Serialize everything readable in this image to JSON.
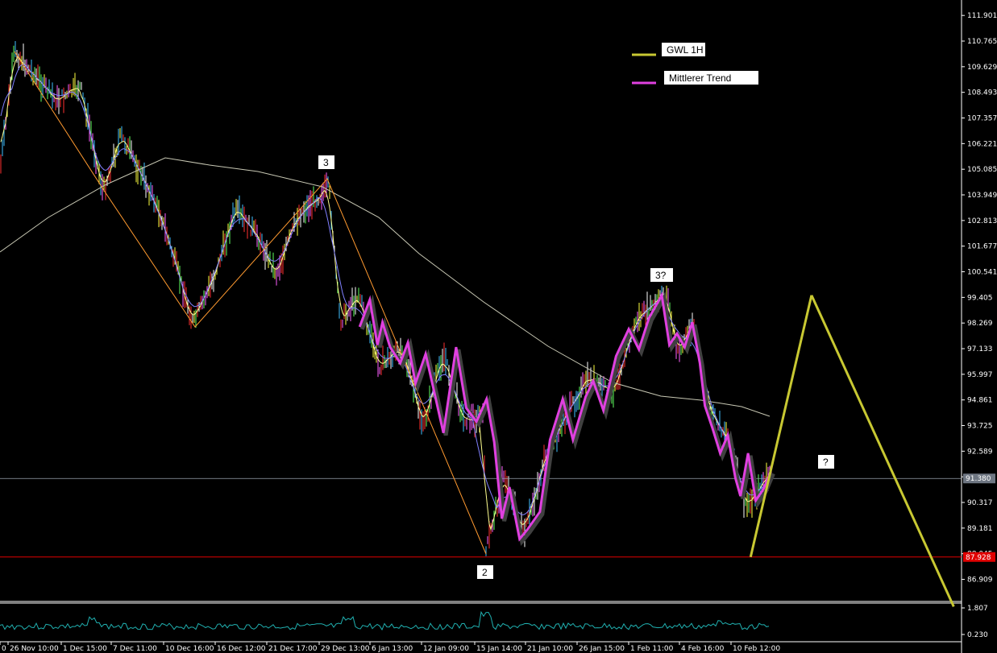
{
  "chart_data": {
    "type": "line",
    "y_ticks": [
      "111.901",
      "110.765",
      "109.629",
      "108.493",
      "107.357",
      "106.221",
      "105.085",
      "103.949",
      "102.813",
      "101.677",
      "100.541",
      "99.405",
      "98.269",
      "97.133",
      "95.997",
      "94.861",
      "93.725",
      "92.589",
      "91.453",
      "90.317",
      "89.181",
      "88.045",
      "86.909"
    ],
    "x_ticks": [
      "0",
      "26 Nov 10:00",
      "1 Dec 15:00",
      "7 Dec 11:00",
      "10 Dec 16:00",
      "16 Dec 12:00",
      "21 Dec 17:00",
      "29 Dec 13:00",
      "6 Jan 13:00",
      "12 Jan 09:00",
      "15 Jan 14:00",
      "21 Jan 10:00",
      "26 Jan 15:00",
      "1 Feb 11:00",
      "4 Feb 16:00",
      "10 Feb 12:00"
    ],
    "ylim": [
      86.0,
      112.3
    ],
    "current_price": {
      "value": 91.38,
      "label": "91.380",
      "color": "#9aa3b0"
    },
    "support_level": {
      "value": 87.9,
      "label": "87.928",
      "color": "#e00000"
    },
    "legend": [
      {
        "label": "GWL 1H",
        "color": "#c8c832"
      },
      {
        "label": "Mittlerer Trend",
        "color": "#e040e0"
      }
    ],
    "wave_labels": [
      {
        "text": "3",
        "x": "29 Dec",
        "y": 105.2
      },
      {
        "text": "3?",
        "x": "2 Feb",
        "y": 100.1
      },
      {
        "text": "2",
        "x": "15 Jan",
        "y": 87.1
      },
      {
        "text": "?",
        "x": "projection",
        "y": 92.0
      }
    ],
    "indicator_ticks": [
      "1.807",
      "0.230"
    ],
    "series": [
      {
        "name": "GWL 1H",
        "values": [
          [
            15.1,
            87.9
          ],
          [
            16.3,
            99.5
          ]
        ],
        "projection": [
          [
            16.3,
            99.5
          ],
          [
            19.1,
            85.7
          ]
        ]
      },
      {
        "name": "Mittlerer Trend",
        "values": [
          [
            7.4,
            98.1
          ],
          [
            7.6,
            99.3
          ],
          [
            7.75,
            97.3
          ],
          [
            7.85,
            98.3
          ],
          [
            8.0,
            97.2
          ],
          [
            8.2,
            96.5
          ],
          [
            8.35,
            97.4
          ],
          [
            8.5,
            95.6
          ],
          [
            8.7,
            96.9
          ],
          [
            8.9,
            94.9
          ],
          [
            9.05,
            93.4
          ],
          [
            9.3,
            97.2
          ],
          [
            9.5,
            94.5
          ],
          [
            9.7,
            93.9
          ],
          [
            9.9,
            94.9
          ],
          [
            10.05,
            93.0
          ],
          [
            10.2,
            89.6
          ],
          [
            10.35,
            91.0
          ],
          [
            10.55,
            88.7
          ],
          [
            10.7,
            89.1
          ],
          [
            10.95,
            89.9
          ],
          [
            11.15,
            93.1
          ],
          [
            11.4,
            94.9
          ],
          [
            11.6,
            93.1
          ],
          [
            11.85,
            95.0
          ],
          [
            12.0,
            95.7
          ],
          [
            12.2,
            94.4
          ],
          [
            12.45,
            96.8
          ],
          [
            12.7,
            98.0
          ],
          [
            12.9,
            97.1
          ],
          [
            13.1,
            98.5
          ],
          [
            13.35,
            99.5
          ],
          [
            13.5,
            97.3
          ],
          [
            13.65,
            97.8
          ],
          [
            13.8,
            97.2
          ],
          [
            13.95,
            98.3
          ],
          [
            14.1,
            96.5
          ],
          [
            14.2,
            94.6
          ],
          [
            14.35,
            93.6
          ],
          [
            14.5,
            92.5
          ],
          [
            14.65,
            93.3
          ],
          [
            14.8,
            91.4
          ],
          [
            14.9,
            90.6
          ],
          [
            15.05,
            92.5
          ],
          [
            15.2,
            90.4
          ],
          [
            15.35,
            90.9
          ],
          [
            15.5,
            91.7
          ]
        ]
      }
    ]
  }
}
